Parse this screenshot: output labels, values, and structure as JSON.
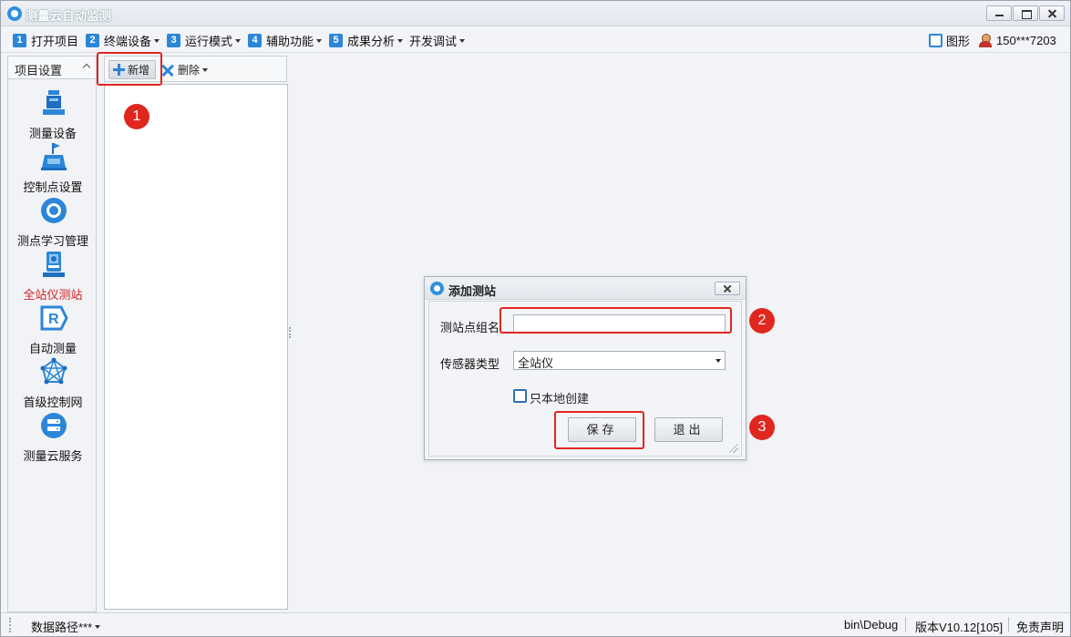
{
  "app": {
    "title": "测量云自动监测"
  },
  "menu": [
    {
      "num": "1",
      "label": "打开项目",
      "dropdown": false
    },
    {
      "num": "2",
      "label": "终端设备",
      "dropdown": true
    },
    {
      "num": "3",
      "label": "运行模式",
      "dropdown": true
    },
    {
      "num": "4",
      "label": "辅助功能",
      "dropdown": true
    },
    {
      "num": "5",
      "label": "成果分析",
      "dropdown": true
    },
    {
      "num": "",
      "label": "开发调试",
      "dropdown": true
    }
  ],
  "menu_right": {
    "graphics_label": "图形",
    "user": "150***7203"
  },
  "sidebar": {
    "header": "项目设置",
    "items": [
      {
        "label": "测量设备",
        "icon": "survey-device-icon",
        "active": false
      },
      {
        "label": "控制点设置",
        "icon": "control-point-icon",
        "active": false
      },
      {
        "label": "测点学习管理",
        "icon": "point-learning-icon",
        "active": false
      },
      {
        "label": "全站仪测站",
        "icon": "total-station-icon",
        "active": true
      },
      {
        "label": "自动测量",
        "icon": "auto-measure-icon",
        "active": false
      },
      {
        "label": "首级控制网",
        "icon": "control-network-icon",
        "active": false
      },
      {
        "label": "测量云服务",
        "icon": "cloud-service-icon",
        "active": false
      }
    ]
  },
  "toolbar": {
    "add_label": "新增",
    "delete_label": "删除"
  },
  "annotations": [
    "1",
    "2",
    "3"
  ],
  "dialog": {
    "title": "添加测站",
    "group_name_label": "测站点组名",
    "group_name_value": "",
    "sensor_type_label": "传感器类型",
    "sensor_type_value": "全站仪",
    "local_only_label": "只本地创建",
    "local_only_checked": false,
    "save_label": "保存",
    "exit_label": "退出"
  },
  "statusbar": {
    "data_path": "数据路径***",
    "bin_path": "bin\\Debug",
    "version": "版本V10.12[105]",
    "disclaimer": "免责声明"
  },
  "colors": {
    "accent": "#2c86d8",
    "active_text": "#d41c1c",
    "annotation": "#e0271e"
  }
}
